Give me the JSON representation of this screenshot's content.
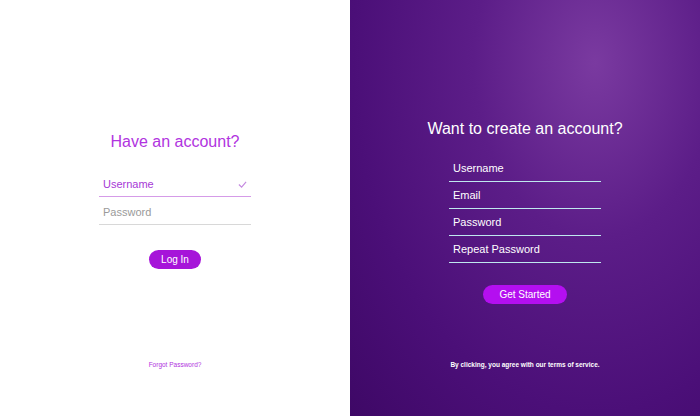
{
  "login": {
    "title": "Have an account?",
    "fields": [
      {
        "placeholder": "Username",
        "focused": true,
        "valid": true
      },
      {
        "placeholder": "Password",
        "focused": false,
        "valid": false
      }
    ],
    "button": "Log In",
    "forgot": "Forgot Password?"
  },
  "signup": {
    "title": "Want to create an account?",
    "fields": [
      {
        "placeholder": "Username"
      },
      {
        "placeholder": "Email"
      },
      {
        "placeholder": "Password"
      },
      {
        "placeholder": "Repeat Password"
      }
    ],
    "button": "Get Started",
    "terms": "By clicking, you agree with our terms of service."
  }
}
